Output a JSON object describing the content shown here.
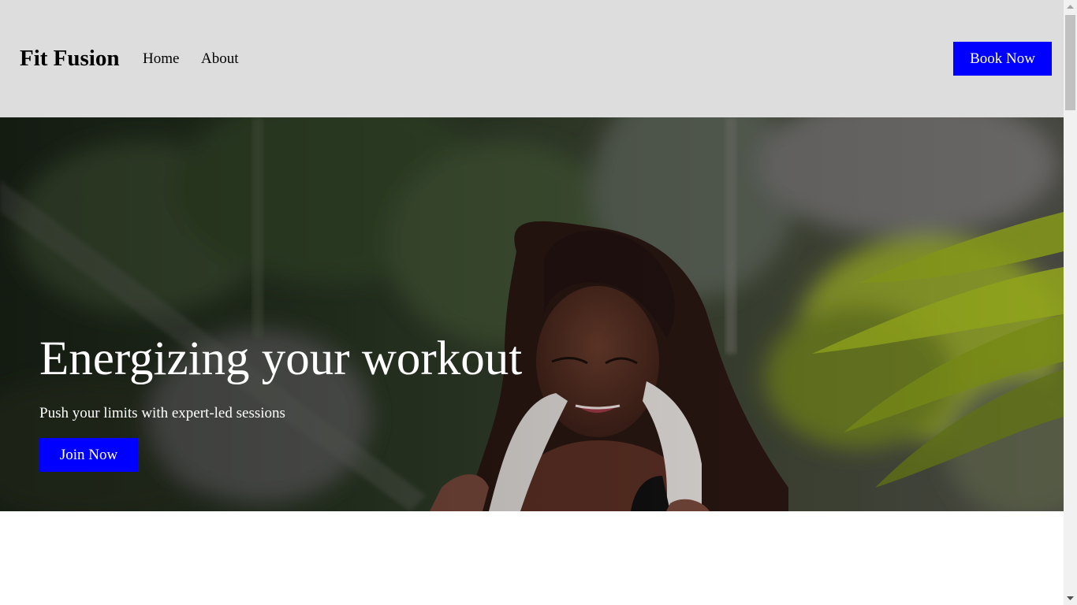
{
  "header": {
    "brand": "Fit Fusion",
    "nav": [
      {
        "label": "Home"
      },
      {
        "label": "About"
      }
    ],
    "cta_label": "Book Now"
  },
  "hero": {
    "title": "Energizing your workout",
    "subtitle": "Push your limits with expert-led sessions",
    "cta_label": "Join Now",
    "image_icon": "woman-with-towel-photo"
  },
  "colors": {
    "header_bg": "#dddddd",
    "accent": "#0000ff",
    "hero_text": "#ffffff",
    "scrollbar_track": "#f1f1f1",
    "scrollbar_thumb": "#c1c1c1"
  },
  "scrollbar": {
    "up_icon": "scroll-up-arrow-icon",
    "down_icon": "scroll-down-arrow-icon",
    "position": 0
  }
}
